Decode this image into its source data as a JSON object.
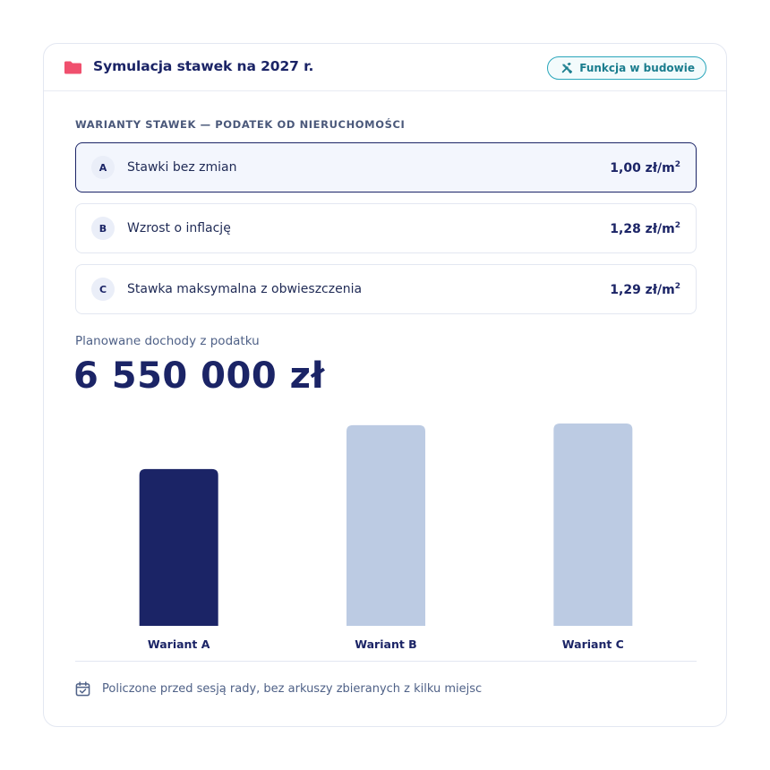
{
  "header": {
    "title": "Symulacja stawek na 2027 r.",
    "badge_label": "Funkcja w budowie",
    "folder_color": "#f0506e"
  },
  "section": {
    "label": "WARIANTY STAWEK — PODATEK OD NIERUCHOMOŚCI"
  },
  "options": [
    {
      "letter": "A",
      "label": "Stawki bez zmian",
      "value": "1,00 zł/m",
      "unit_sup": "2",
      "selected": true
    },
    {
      "letter": "B",
      "label": "Wzrost o inflację",
      "value": "1,28 zł/m",
      "unit_sup": "2",
      "selected": false
    },
    {
      "letter": "C",
      "label": "Stawka maksymalna z obwieszczenia",
      "value": "1,29 zł/m",
      "unit_sup": "2",
      "selected": false
    }
  ],
  "income": {
    "label": "Planowane dochody z podatku",
    "value": "6 550 000 zł"
  },
  "chart_data": {
    "type": "bar",
    "categories": [
      "Wariant A",
      "Wariant B",
      "Wariant C"
    ],
    "values": [
      6550000,
      8380000,
      8450000
    ],
    "highlight_index": 0,
    "colors": {
      "highlight": "#1b2466",
      "default": "#bccbe3"
    },
    "ylim": [
      0,
      8450000
    ],
    "title": "",
    "xlabel": "",
    "ylabel": ""
  },
  "footer": {
    "text": "Policzone przed sesją rady, bez arkuszy zbieranych z kilku miejsc"
  },
  "colors": {
    "primary": "#1b2466",
    "accent_teal": "#1a7d8e"
  }
}
